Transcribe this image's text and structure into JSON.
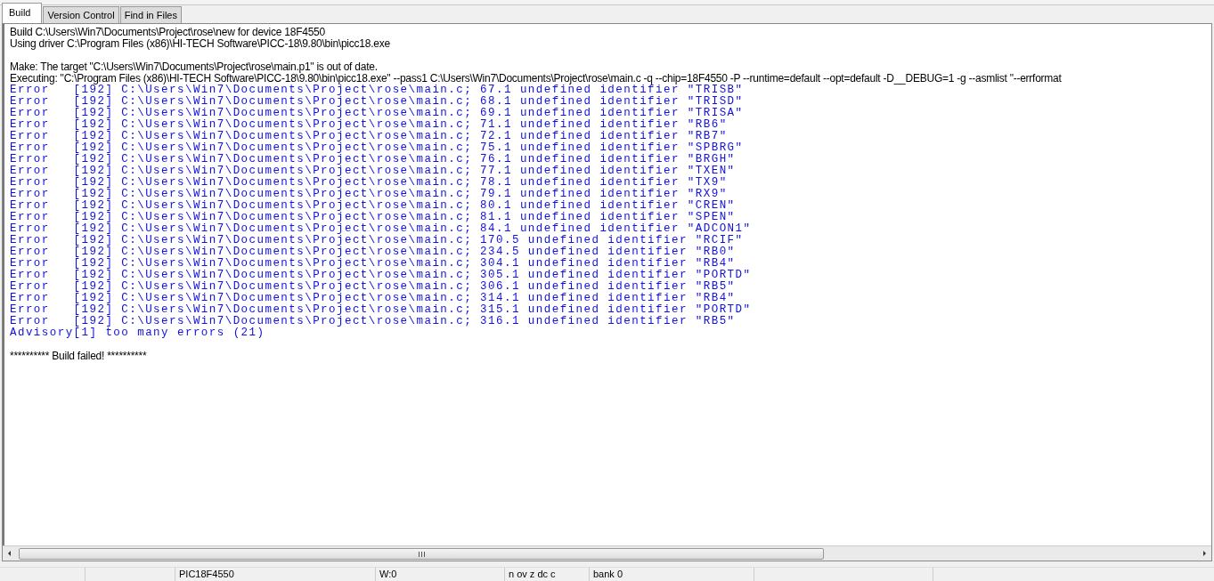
{
  "tabs": [
    {
      "label": "Build",
      "selected": true
    },
    {
      "label": "Version Control",
      "selected": false
    },
    {
      "label": "Find in Files",
      "selected": false
    }
  ],
  "output": [
    {
      "kind": "text",
      "text": "Build C:\\Users\\Win7\\Documents\\Project\\rose\\new for device 18F4550"
    },
    {
      "kind": "text",
      "text": "Using driver C:\\Program Files (x86)\\HI-TECH Software\\PICC-18\\9.80\\bin\\picc18.exe"
    },
    {
      "kind": "blank"
    },
    {
      "kind": "text",
      "text": "Make: The target \"C:\\Users\\Win7\\Documents\\Project\\rose\\main.p1\" is out of date."
    },
    {
      "kind": "text",
      "text": "Executing: \"C:\\Program Files (x86)\\HI-TECH Software\\PICC-18\\9.80\\bin\\picc18.exe\" --pass1 C:\\Users\\Win7\\Documents\\Project\\rose\\main.c -q --chip=18F4550 -P --runtime=default --opt=default -D__DEBUG=1 -g --asmlist \"--errformat"
    },
    {
      "kind": "error",
      "text": "Error   [192] C:\\Users\\Win7\\Documents\\Project\\rose\\main.c; 67.1 undefined identifier \"TRISB\""
    },
    {
      "kind": "error",
      "text": "Error   [192] C:\\Users\\Win7\\Documents\\Project\\rose\\main.c; 68.1 undefined identifier \"TRISD\""
    },
    {
      "kind": "error",
      "text": "Error   [192] C:\\Users\\Win7\\Documents\\Project\\rose\\main.c; 69.1 undefined identifier \"TRISA\""
    },
    {
      "kind": "error",
      "text": "Error   [192] C:\\Users\\Win7\\Documents\\Project\\rose\\main.c; 71.1 undefined identifier \"RB6\""
    },
    {
      "kind": "error",
      "text": "Error   [192] C:\\Users\\Win7\\Documents\\Project\\rose\\main.c; 72.1 undefined identifier \"RB7\""
    },
    {
      "kind": "error",
      "text": "Error   [192] C:\\Users\\Win7\\Documents\\Project\\rose\\main.c; 75.1 undefined identifier \"SPBRG\""
    },
    {
      "kind": "error",
      "text": "Error   [192] C:\\Users\\Win7\\Documents\\Project\\rose\\main.c; 76.1 undefined identifier \"BRGH\""
    },
    {
      "kind": "error",
      "text": "Error   [192] C:\\Users\\Win7\\Documents\\Project\\rose\\main.c; 77.1 undefined identifier \"TXEN\""
    },
    {
      "kind": "error",
      "text": "Error   [192] C:\\Users\\Win7\\Documents\\Project\\rose\\main.c; 78.1 undefined identifier \"TX9\""
    },
    {
      "kind": "error",
      "text": "Error   [192] C:\\Users\\Win7\\Documents\\Project\\rose\\main.c; 79.1 undefined identifier \"RX9\""
    },
    {
      "kind": "error",
      "text": "Error   [192] C:\\Users\\Win7\\Documents\\Project\\rose\\main.c; 80.1 undefined identifier \"CREN\""
    },
    {
      "kind": "error",
      "text": "Error   [192] C:\\Users\\Win7\\Documents\\Project\\rose\\main.c; 81.1 undefined identifier \"SPEN\""
    },
    {
      "kind": "error",
      "text": "Error   [192] C:\\Users\\Win7\\Documents\\Project\\rose\\main.c; 84.1 undefined identifier \"ADCON1\""
    },
    {
      "kind": "error",
      "text": "Error   [192] C:\\Users\\Win7\\Documents\\Project\\rose\\main.c; 170.5 undefined identifier \"RCIF\""
    },
    {
      "kind": "error",
      "text": "Error   [192] C:\\Users\\Win7\\Documents\\Project\\rose\\main.c; 234.5 undefined identifier \"RB0\""
    },
    {
      "kind": "error",
      "text": "Error   [192] C:\\Users\\Win7\\Documents\\Project\\rose\\main.c; 304.1 undefined identifier \"RB4\""
    },
    {
      "kind": "error",
      "text": "Error   [192] C:\\Users\\Win7\\Documents\\Project\\rose\\main.c; 305.1 undefined identifier \"PORTD\""
    },
    {
      "kind": "error",
      "text": "Error   [192] C:\\Users\\Win7\\Documents\\Project\\rose\\main.c; 306.1 undefined identifier \"RB5\""
    },
    {
      "kind": "error",
      "text": "Error   [192] C:\\Users\\Win7\\Documents\\Project\\rose\\main.c; 314.1 undefined identifier \"RB4\""
    },
    {
      "kind": "error",
      "text": "Error   [192] C:\\Users\\Win7\\Documents\\Project\\rose\\main.c; 315.1 undefined identifier \"PORTD\""
    },
    {
      "kind": "error",
      "text": "Error   [192] C:\\Users\\Win7\\Documents\\Project\\rose\\main.c; 316.1 undefined identifier \"RB5\""
    },
    {
      "kind": "error",
      "text": "Advisory[1] too many errors (21)"
    },
    {
      "kind": "blank"
    },
    {
      "kind": "text",
      "text": "********** Build failed! **********"
    }
  ],
  "status_bar": [
    "PIC18F4550",
    "W:0",
    "n ov z dc c",
    "bank 0"
  ]
}
